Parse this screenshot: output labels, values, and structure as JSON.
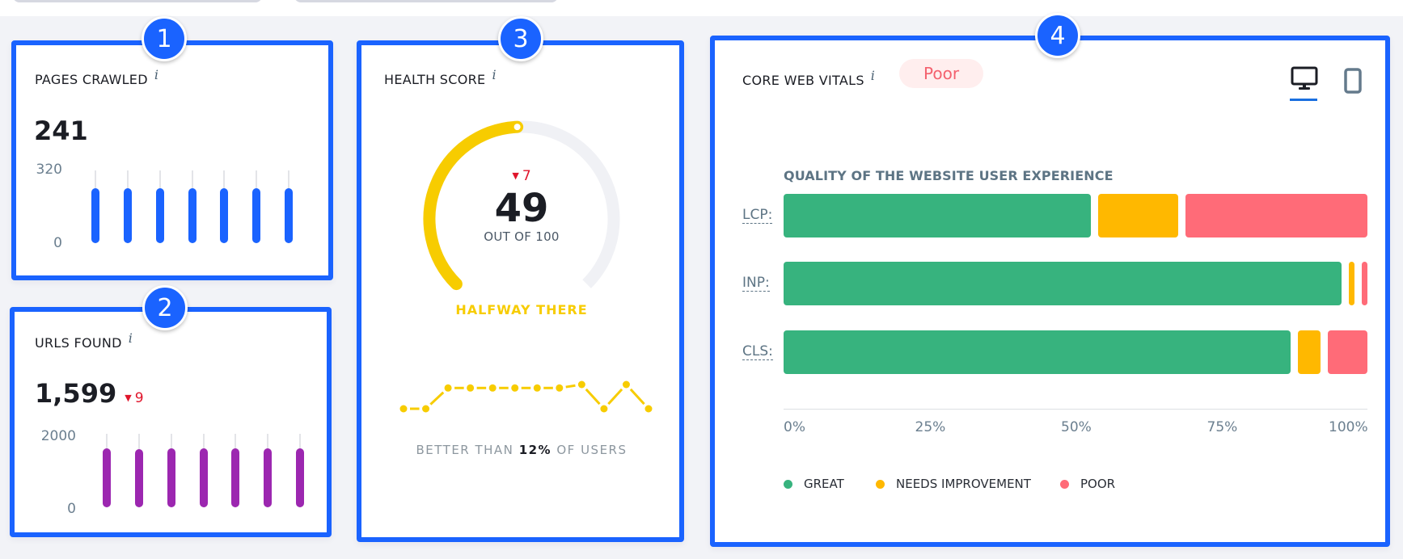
{
  "colors": {
    "accent": "#1a63ff",
    "great": "#37b37e",
    "needs_improvement": "#ffb800",
    "poor": "#ff6b78",
    "gauge": "#f7cc00",
    "gauge_track": "#f0f1f5",
    "urls_bar": "#9c27b0",
    "pages_bar": "#1a63ff",
    "delta_down": "#e0152b"
  },
  "badges": [
    "1",
    "2",
    "3",
    "4"
  ],
  "pages_crawled": {
    "title": "PAGES CRAWLED",
    "info": "i",
    "value": "241",
    "axis_max": "320",
    "axis_min": "0",
    "chart_data": {
      "type": "bar",
      "ylim": [
        0,
        320
      ],
      "values": [
        241,
        241,
        241,
        241,
        241,
        241,
        241
      ]
    }
  },
  "urls_found": {
    "title": "URLS FOUND",
    "info": "i",
    "value": "1,599",
    "delta": "9",
    "delta_icon": "▼",
    "axis_max": "2000",
    "axis_min": "0",
    "chart_data": {
      "type": "bar",
      "ylim": [
        0,
        2000
      ],
      "values": [
        1599,
        1590,
        1599,
        1599,
        1599,
        1599,
        1599
      ]
    }
  },
  "health_score": {
    "title": "HEALTH SCORE",
    "info": "i",
    "score": 49,
    "score_text": "49",
    "max": 100,
    "out_of": "OUT OF 100",
    "delta": "7",
    "delta_icon": "▼",
    "status": "HALFWAY THERE",
    "better_prefix": "BETTER THAN",
    "better_value": "12%",
    "better_suffix": "OF USERS",
    "chart_data": {
      "type": "line",
      "values": [
        49,
        49,
        55,
        55,
        55,
        55,
        55,
        55,
        56,
        49,
        56,
        49
      ],
      "ylim": [
        40,
        60
      ]
    }
  },
  "core_web_vitals": {
    "title": "CORE WEB VITALS",
    "info": "i",
    "status_pill": "Poor",
    "devices": [
      {
        "name": "desktop",
        "icon": "desktop-icon",
        "active": true
      },
      {
        "name": "mobile",
        "icon": "mobile-icon",
        "active": false
      }
    ],
    "subtitle": "QUALITY OF THE WEBSITE USER EXPERIENCE",
    "chart_data": {
      "type": "bar",
      "orientation": "horizontal-stacked",
      "categories": [
        "LCP:",
        "INP:",
        "CLS:"
      ],
      "series": [
        {
          "name": "GREAT",
          "values": [
            54,
            98,
            89
          ]
        },
        {
          "name": "NEEDS IMPROVEMENT",
          "values": [
            14,
            1,
            4
          ]
        },
        {
          "name": "POOR",
          "values": [
            32,
            1,
            7
          ]
        }
      ],
      "xlim": [
        0,
        100
      ],
      "xticks": [
        "0%",
        "25%",
        "50%",
        "75%",
        "100%"
      ],
      "legend": [
        "GREAT",
        "NEEDS IMPROVEMENT",
        "POOR"
      ],
      "legend_position": "bottom-left"
    }
  }
}
